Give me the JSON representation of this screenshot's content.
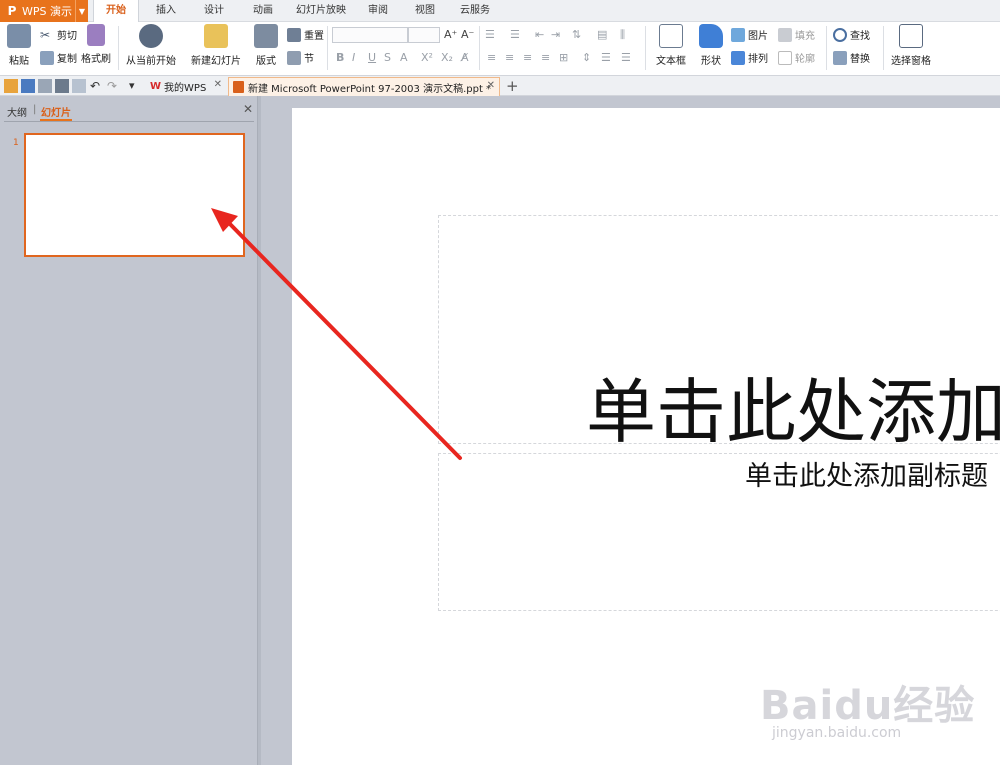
{
  "app": {
    "name": "WPS 演示"
  },
  "menu": {
    "tabs": [
      "开始",
      "插入",
      "设计",
      "动画",
      "幻灯片放映",
      "审阅",
      "视图",
      "云服务"
    ],
    "active_tab": "开始"
  },
  "ribbon": {
    "paste": "粘贴",
    "cut": "剪切",
    "copy": "复制",
    "format_painter": "格式刷",
    "from_current": "从当前开始",
    "new_slide": "新建幻灯片",
    "layout": "版式",
    "reset": "重置",
    "section": "节",
    "text_box": "文本框",
    "shape": "形状",
    "picture": "图片",
    "fill": "填充",
    "arrange": "排列",
    "outline": "轮廓",
    "find": "查找",
    "replace": "替换",
    "select_pane": "选择窗格"
  },
  "doc_tabs": [
    {
      "label": "我的WPS",
      "active": false
    },
    {
      "label": "新建 Microsoft PowerPoint 97-2003 演示文稿.ppt *",
      "active": true
    }
  ],
  "left_panel": {
    "outline_tab": "大纲",
    "slides_tab": "幻灯片",
    "slide_number": "1"
  },
  "slide": {
    "title_placeholder": "单击此处添加标题",
    "subtitle_placeholder": "单击此处添加副标题"
  },
  "watermark": {
    "logo": "Baidu经验",
    "url": "jingyan.baidu.com"
  },
  "colors": {
    "accent": "#e8731c",
    "annotation_arrow": "#e8261f"
  }
}
